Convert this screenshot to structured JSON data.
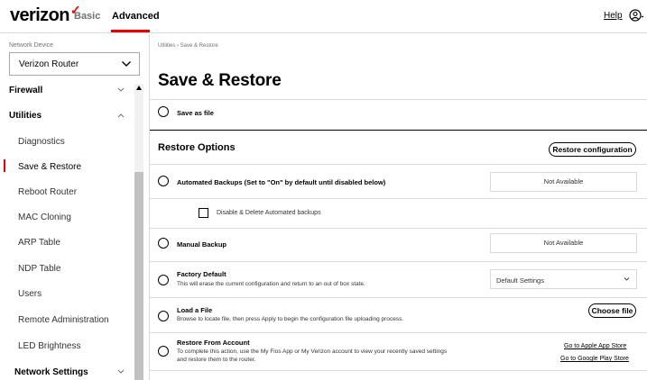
{
  "header": {
    "logo_text": "verizon",
    "logo_mark": "✓",
    "tabs": [
      {
        "label": "Basic"
      },
      {
        "label": "Advanced",
        "active": true
      }
    ],
    "help_label": "Help",
    "user_icon": "user-icon",
    "brand_color": "#ee0000"
  },
  "sidebar": {
    "device_label": "Network Device",
    "device_value": "Verizon Router",
    "items": [
      {
        "label": "Firewall",
        "type": "section",
        "expanded": false
      },
      {
        "label": "Utilities",
        "type": "section",
        "expanded": true
      },
      {
        "label": "Diagnostics"
      },
      {
        "label": "Save & Restore",
        "active": true
      },
      {
        "label": "Reboot Router"
      },
      {
        "label": "MAC Cloning"
      },
      {
        "label": "ARP Table"
      },
      {
        "label": "NDP Table"
      },
      {
        "label": "Users"
      },
      {
        "label": "Remote Administration"
      },
      {
        "label": "LED Brightness"
      },
      {
        "label": "Network Settings",
        "type": "section",
        "expanded": false
      }
    ]
  },
  "main": {
    "breadcrumb": "Utilities  ›  Save & Restore",
    "title": "Save & Restore",
    "save_as_file": "Save as file",
    "restore_options_title": "Restore Options",
    "restore_config_button": "Restore configuration",
    "automated_backups": {
      "label": "Automated Backups (Set to \"On\" by default until disabled below)",
      "status": "Not Available",
      "checkbox_label": "Disable & Delete Automated backups"
    },
    "manual_backup": {
      "label": "Manual Backup",
      "status": "Not Available"
    },
    "factory_default": {
      "label": "Factory Default",
      "description": "This will erase the current configuration and return to an out of box state.",
      "select_value": "Default Settings"
    },
    "load_file": {
      "label": "Load a File",
      "description": "Browse to locate file, then press Apply to begin the configuration file uploading process.",
      "button": "Choose file"
    },
    "restore_from_account": {
      "label": "Restore From Account",
      "description_line1": "To complete this action, use the My Fios App or My Verizon account to view your recently saved settings",
      "description_line2": "and restore them to the router.",
      "link_app_store": "Go to Apple App Store",
      "link_play_store": "Go to Google Play Store"
    }
  }
}
